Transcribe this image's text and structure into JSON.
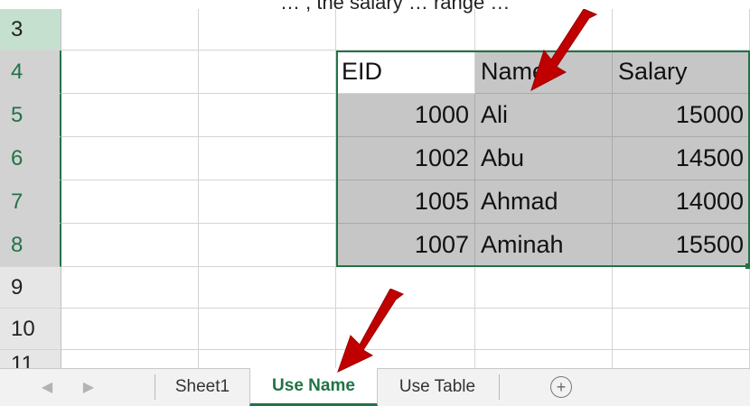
{
  "partial_top_text": "… , the salary … range …",
  "rows": [
    {
      "num": "3",
      "eid": "",
      "name": "",
      "salary": ""
    },
    {
      "num": "4",
      "eid": "EID",
      "name": "Name",
      "salary": "Salary"
    },
    {
      "num": "5",
      "eid": "1000",
      "name": "Ali",
      "salary": "15000"
    },
    {
      "num": "6",
      "eid": "1002",
      "name": "Abu",
      "salary": "14500"
    },
    {
      "num": "7",
      "eid": "1005",
      "name": "Ahmad",
      "salary": "14000"
    },
    {
      "num": "8",
      "eid": "1007",
      "name": "Aminah",
      "salary": "15500"
    },
    {
      "num": "9",
      "eid": "",
      "name": "",
      "salary": ""
    },
    {
      "num": "10",
      "eid": "",
      "name": "",
      "salary": ""
    },
    {
      "num": "11",
      "eid": "",
      "name": "",
      "salary": ""
    }
  ],
  "tabs": {
    "sheet1": "Sheet1",
    "use_name": "Use Name",
    "use_table": "Use Table",
    "add_icon": "⊕",
    "prev_icon": "◀",
    "next_icon": "▶"
  },
  "colors": {
    "accent": "#217346",
    "selection_fill": "#c6c6c6",
    "arrow": "#c00000"
  }
}
